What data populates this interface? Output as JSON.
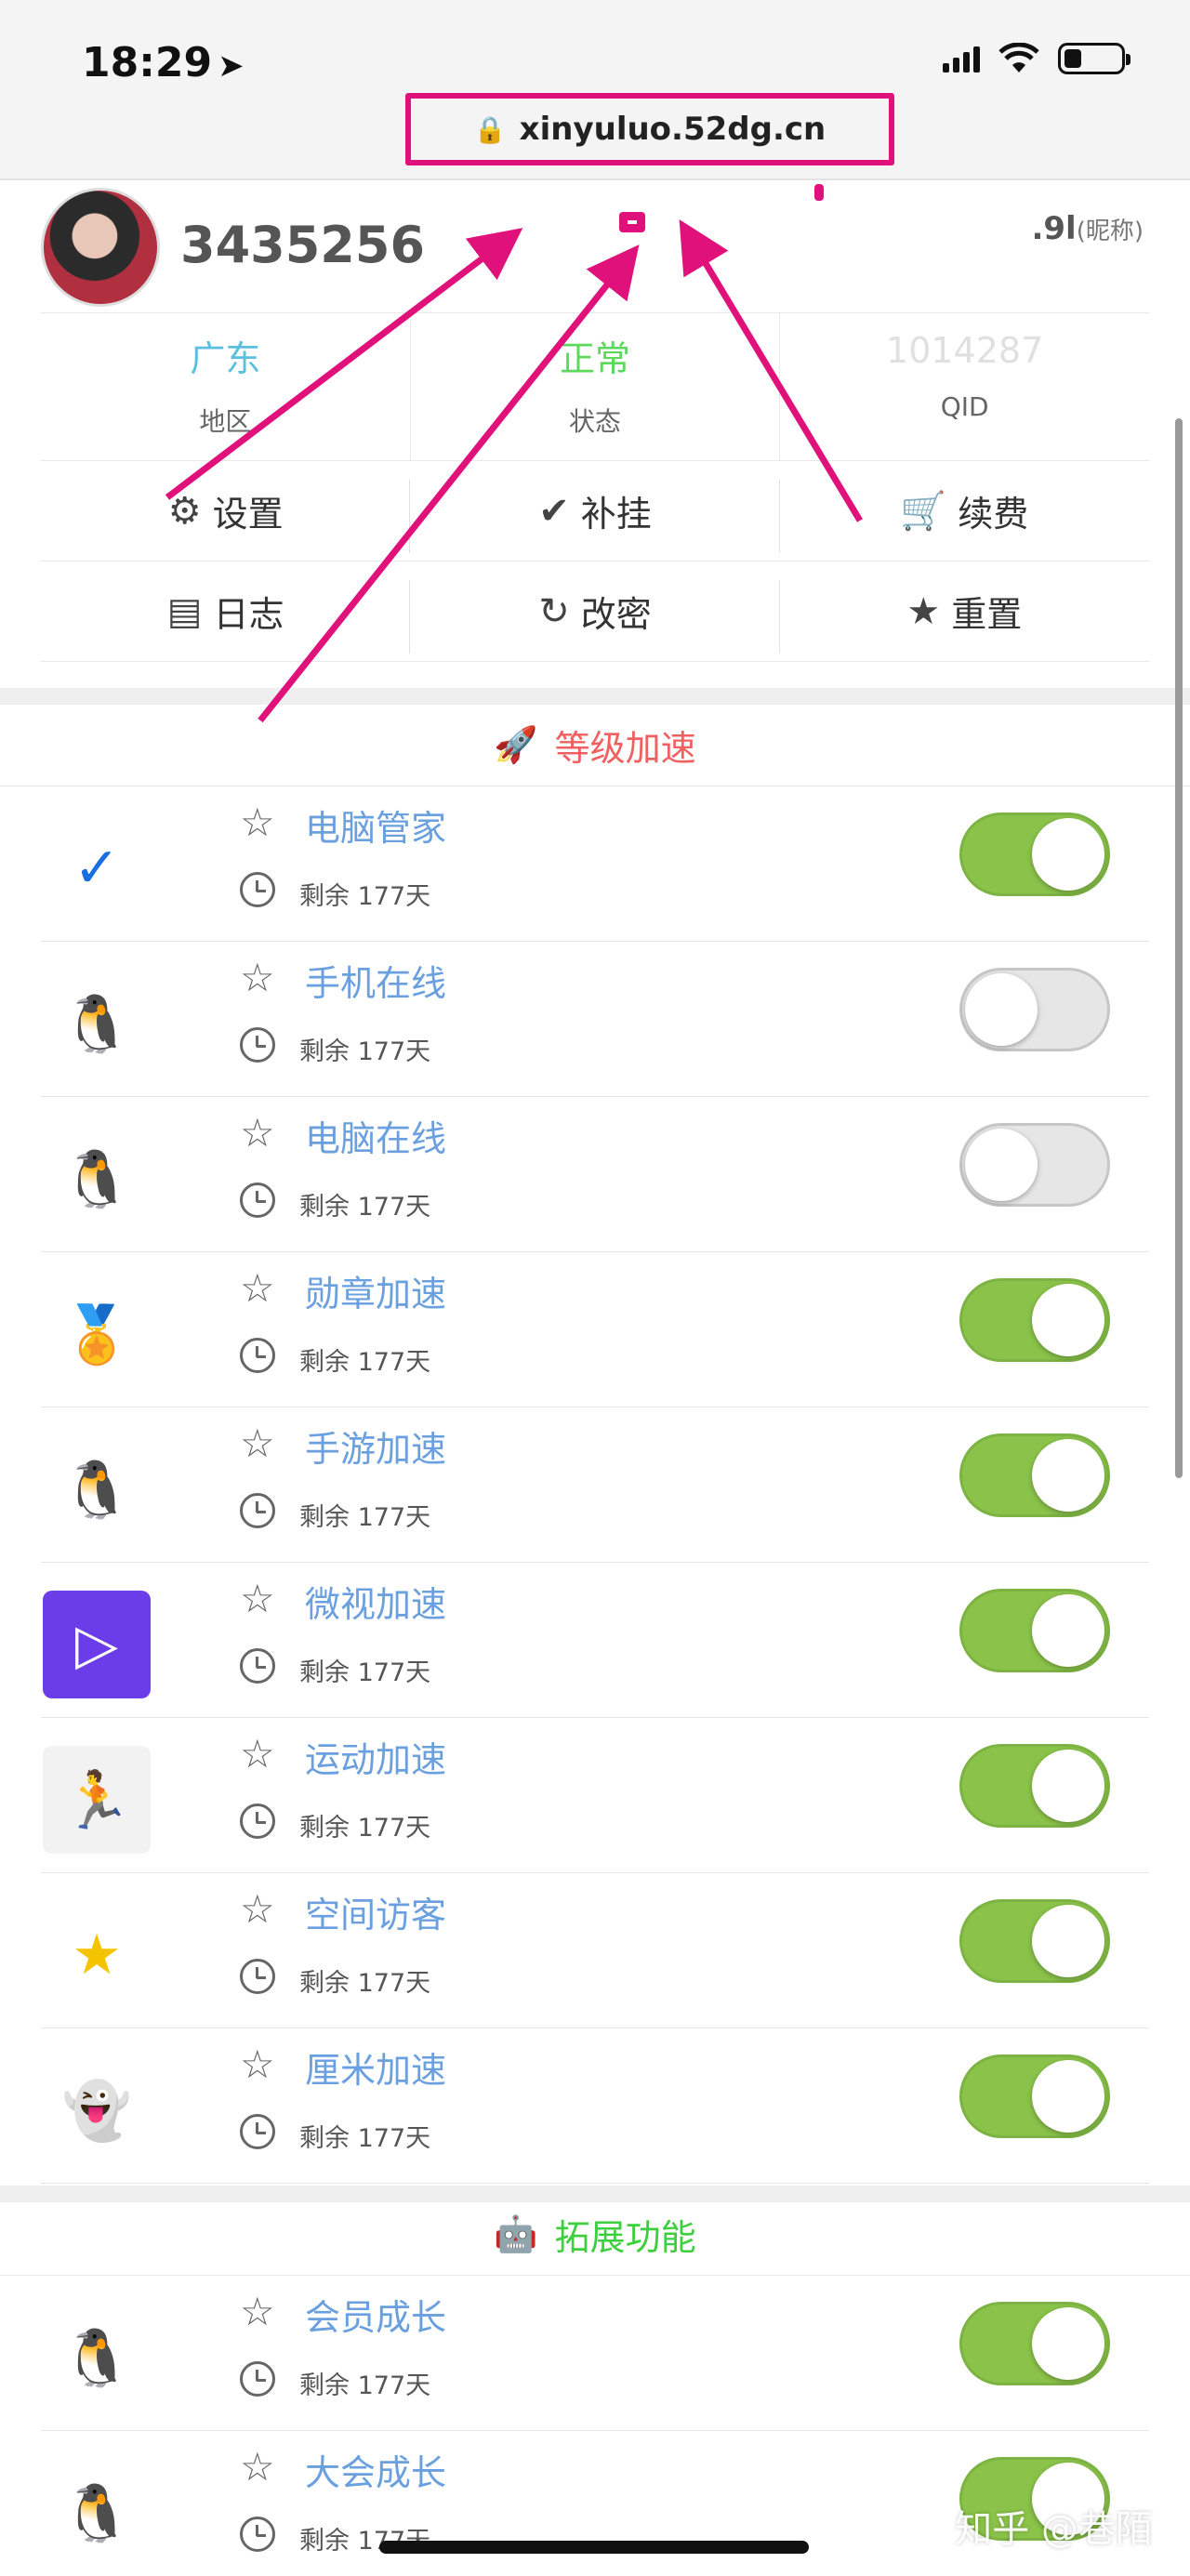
{
  "status_bar": {
    "time": "18:29",
    "location_icon": "location-arrow-icon"
  },
  "browser": {
    "url": "xinyuluo.52dg.cn"
  },
  "profile": {
    "user_id": "3435256",
    "nickname_value": ".9l",
    "nickname_label": "(昵称)",
    "stats": [
      {
        "value": "广东",
        "label": "地区",
        "color": "#5bc0de"
      },
      {
        "value": "正常",
        "label": "状态",
        "color": "#5cd85c"
      },
      {
        "value": "1014287",
        "label": "QID",
        "color": "#e0e0e0"
      }
    ],
    "actions": [
      {
        "label": "设置",
        "icon": "gears-icon",
        "glyph": "⚙"
      },
      {
        "label": "补挂",
        "icon": "check-icon",
        "glyph": "✔"
      },
      {
        "label": "续费",
        "icon": "cart-icon",
        "glyph": "🛒"
      },
      {
        "label": "日志",
        "icon": "list-icon",
        "glyph": "▤"
      },
      {
        "label": "改密",
        "icon": "redo-icon",
        "glyph": "↻"
      },
      {
        "label": "重置",
        "icon": "star-icon",
        "glyph": "★"
      }
    ]
  },
  "sections": {
    "level": {
      "title": "等级加速",
      "icon": "rocket-icon",
      "items": [
        {
          "name": "电脑管家",
          "remain": "剩余 177天",
          "on": true,
          "logo": "pc-manager-logo",
          "glyph": "✓",
          "bg": "#ffffff",
          "fg": "#1a6fe0"
        },
        {
          "name": "手机在线",
          "remain": "剩余 177天",
          "on": false,
          "logo": "qq-mobile-logo",
          "glyph": "🐧",
          "bg": "#ffffff",
          "fg": "#f0b000"
        },
        {
          "name": "电脑在线",
          "remain": "剩余 177天",
          "on": false,
          "logo": "qq-pc-logo",
          "glyph": "🐧",
          "bg": "#ffffff",
          "fg": "#111111"
        },
        {
          "name": "勋章加速",
          "remain": "剩余 177天",
          "on": true,
          "logo": "medal-logo",
          "glyph": "🏅",
          "bg": "#ffffff",
          "fg": "#c0392b"
        },
        {
          "name": "手游加速",
          "remain": "剩余 177天",
          "on": true,
          "logo": "mobile-game-logo",
          "glyph": "🐧",
          "bg": "#ffffff",
          "fg": "#1a8fe0"
        },
        {
          "name": "微视加速",
          "remain": "剩余 177天",
          "on": true,
          "logo": "weishi-logo",
          "glyph": "▷",
          "bg": "#6a3de8",
          "fg": "#ffffff"
        },
        {
          "name": "运动加速",
          "remain": "剩余 177天",
          "on": true,
          "logo": "sport-logo",
          "glyph": "🏃",
          "bg": "#f2f2f2",
          "fg": "#1a8fe0"
        },
        {
          "name": "空间访客",
          "remain": "剩余 177天",
          "on": true,
          "logo": "qzone-logo",
          "glyph": "★",
          "bg": "#ffffff",
          "fg": "#f5c400"
        },
        {
          "name": "厘米加速",
          "remain": "剩余 177天",
          "on": true,
          "logo": "cmshow-logo",
          "glyph": "👻",
          "bg": "#ffffff",
          "fg": "#7a4de0"
        }
      ]
    },
    "extend": {
      "title": "拓展功能",
      "icon": "robot-icon",
      "items": [
        {
          "name": "会员成长",
          "remain": "剩余 177天",
          "on": true,
          "logo": "vip-growth-logo",
          "glyph": "🐧",
          "bg": "#ffffff",
          "fg": "#d0211b"
        },
        {
          "name": "大会成长",
          "remain": "剩余 177天",
          "on": true,
          "logo": "svip-growth-logo",
          "glyph": "🐧",
          "bg": "#ffffff",
          "fg": "#e0117a"
        }
      ]
    }
  },
  "watermark": "知乎 @巷陌",
  "colors": {
    "accent": "#e0117a",
    "toggle_on": "#8bc34a",
    "link": "#6a9fe0"
  }
}
